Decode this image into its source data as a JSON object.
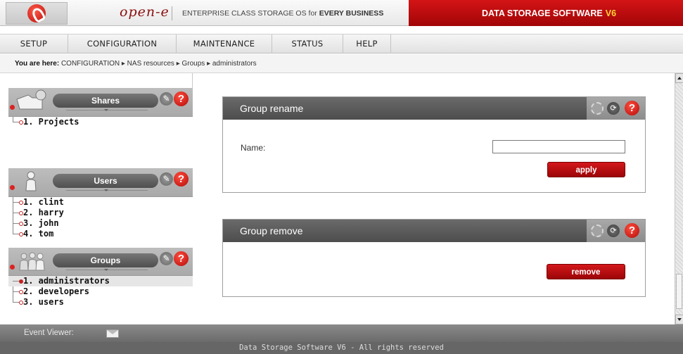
{
  "header": {
    "brand": "open-e",
    "tagline_prefix": "ENTERPRISE CLASS STORAGE OS for ",
    "tagline_strong": "EVERY BUSINESS",
    "product": "DATA STORAGE SOFTWARE",
    "version": "V6"
  },
  "menu": [
    "SETUP",
    "CONFIGURATION",
    "MAINTENANCE",
    "STATUS",
    "HELP"
  ],
  "breadcrumb": {
    "label": "You are here:",
    "path": "CONFIGURATION ▸ NAS resources ▸ Groups ▸ administrators"
  },
  "sidebar": {
    "shares": {
      "title": "Shares",
      "items": [
        "1. Projects"
      ]
    },
    "users": {
      "title": "Users",
      "items": [
        "1. clint",
        "2. harry",
        "3. john",
        "4. tom"
      ]
    },
    "groups": {
      "title": "Groups",
      "items": [
        "1. administrators",
        "2. developers",
        "3. users"
      ],
      "selected": 0
    }
  },
  "rename_panel": {
    "title": "Group rename",
    "name_label": "Name:",
    "name_value": "",
    "apply_label": "apply"
  },
  "remove_panel": {
    "title": "Group remove",
    "remove_label": "remove"
  },
  "event_viewer": {
    "label": "Event Viewer:"
  },
  "footer": {
    "text": "Data Storage Software V6 - All rights reserved"
  },
  "icons": {
    "logo": "open-e-logo-icon",
    "share": "folder-share-icon",
    "user": "user-icon",
    "group": "group-icon",
    "wrench": "wrench-icon",
    "help": "help-icon",
    "gear": "gear-icon",
    "refresh": "refresh-icon",
    "mail": "envelope-icon"
  },
  "colors": {
    "accent": "#c0100f",
    "version": "#ffd43b",
    "panel_header": "#555555"
  }
}
